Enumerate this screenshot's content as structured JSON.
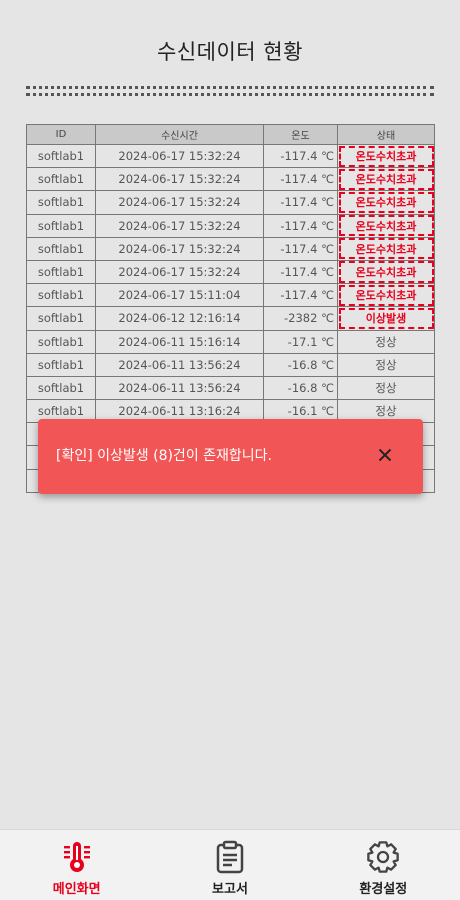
{
  "header": {
    "title": "수신데이터 현황"
  },
  "table": {
    "columns": [
      "ID",
      "수신시간",
      "온도",
      "상태"
    ],
    "rows": [
      {
        "id": "softlab1",
        "time": "2024-06-17 15:32:24",
        "temp": "-117.4 ℃",
        "status": "온도수치초과",
        "alert": true
      },
      {
        "id": "softlab1",
        "time": "2024-06-17 15:32:24",
        "temp": "-117.4 ℃",
        "status": "온도수치초과",
        "alert": true
      },
      {
        "id": "softlab1",
        "time": "2024-06-17 15:32:24",
        "temp": "-117.4 ℃",
        "status": "온도수치초과",
        "alert": true
      },
      {
        "id": "softlab1",
        "time": "2024-06-17 15:32:24",
        "temp": "-117.4 ℃",
        "status": "온도수치초과",
        "alert": true
      },
      {
        "id": "softlab1",
        "time": "2024-06-17 15:32:24",
        "temp": "-117.4 ℃",
        "status": "온도수치초과",
        "alert": true
      },
      {
        "id": "softlab1",
        "time": "2024-06-17 15:32:24",
        "temp": "-117.4 ℃",
        "status": "온도수치초과",
        "alert": true
      },
      {
        "id": "softlab1",
        "time": "2024-06-17 15:11:04",
        "temp": "-117.4 ℃",
        "status": "온도수치초과",
        "alert": true
      },
      {
        "id": "softlab1",
        "time": "2024-06-12 12:16:14",
        "temp": "-2382 ℃",
        "status": "이상발생",
        "alert": true
      },
      {
        "id": "softlab1",
        "time": "2024-06-11 15:16:14",
        "temp": "-17.1 ℃",
        "status": "정상",
        "alert": false
      },
      {
        "id": "softlab1",
        "time": "2024-06-11 13:56:24",
        "temp": "-16.8 ℃",
        "status": "정상",
        "alert": false
      },
      {
        "id": "softlab1",
        "time": "2024-06-11 13:56:24",
        "temp": "-16.8 ℃",
        "status": "정상",
        "alert": false
      },
      {
        "id": "softlab1",
        "time": "2024-06-11 13:16:24",
        "temp": "-16.1 ℃",
        "status": "정상",
        "alert": false
      },
      {
        "id": "",
        "time": "",
        "temp": "",
        "status": "",
        "alert": false
      },
      {
        "id": "",
        "time": "",
        "temp": "",
        "status": "",
        "alert": false
      },
      {
        "id": "",
        "time": "",
        "temp": "",
        "status": "",
        "alert": false
      }
    ]
  },
  "toast": {
    "message": "[확인] 이상발생 (8)건이 존재합니다.",
    "close_icon": "close-icon"
  },
  "nav": {
    "items": [
      {
        "label": "메인화면",
        "icon": "thermometer-icon",
        "active": true
      },
      {
        "label": "보고서",
        "icon": "clipboard-icon",
        "active": false
      },
      {
        "label": "환경설정",
        "icon": "gear-icon",
        "active": false
      }
    ]
  },
  "colors": {
    "alert": "#e8001c",
    "toast": "#f25555",
    "background": "#e5e5e5"
  }
}
